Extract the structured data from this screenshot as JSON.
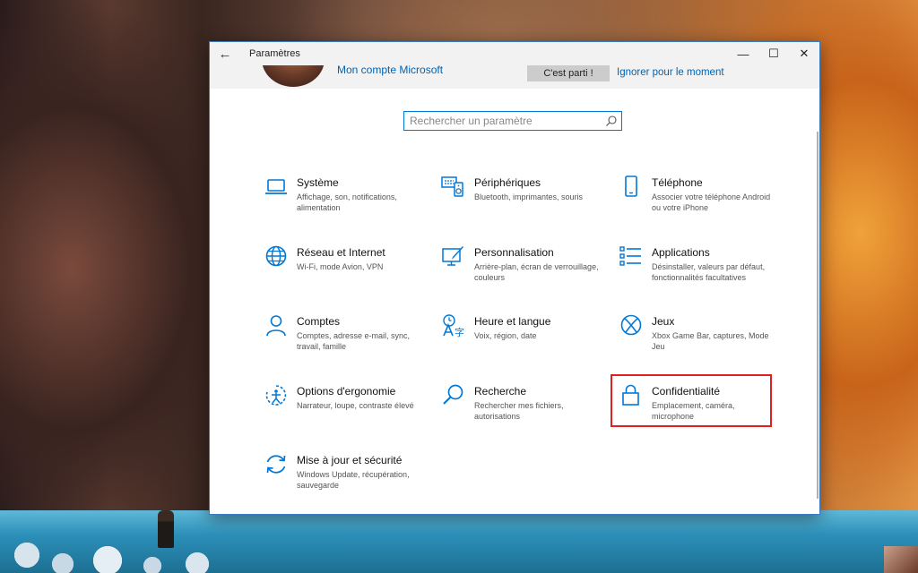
{
  "window": {
    "title": "Paramètres",
    "back_glyph": "←",
    "minimize_glyph": "—",
    "maximize_glyph": "☐",
    "close_glyph": "✕"
  },
  "banner": {
    "account_link": "Mon compte Microsoft",
    "start_button": "C'est parti !",
    "ignore_link": "Ignorer pour le moment"
  },
  "search": {
    "placeholder": "Rechercher un paramètre",
    "icon": "search-icon"
  },
  "categories": [
    {
      "label": "Système",
      "desc": "Affichage, son, notifications, alimentation",
      "icon": "laptop-icon"
    },
    {
      "label": "Périphériques",
      "desc": "Bluetooth, imprimantes, souris",
      "icon": "keyboard-speaker-icon"
    },
    {
      "label": "Téléphone",
      "desc": "Associer votre téléphone Android ou votre iPhone",
      "icon": "phone-icon"
    },
    {
      "label": "Réseau et Internet",
      "desc": "Wi-Fi, mode Avion, VPN",
      "icon": "globe-icon"
    },
    {
      "label": "Personnalisation",
      "desc": "Arrière-plan, écran de verrouillage, couleurs",
      "icon": "paint-icon"
    },
    {
      "label": "Applications",
      "desc": "Désinstaller, valeurs par défaut, fonctionnalités facultatives",
      "icon": "apps-list-icon"
    },
    {
      "label": "Comptes",
      "desc": "Comptes, adresse e-mail, sync, travail, famille",
      "icon": "person-icon"
    },
    {
      "label": "Heure et langue",
      "desc": "Voix, région, date",
      "icon": "time-language-icon"
    },
    {
      "label": "Jeux",
      "desc": "Xbox Game Bar, captures, Mode Jeu",
      "icon": "xbox-icon"
    },
    {
      "label": "Options d'ergonomie",
      "desc": "Narrateur, loupe, contraste élevé",
      "icon": "ease-of-access-icon"
    },
    {
      "label": "Recherche",
      "desc": "Rechercher mes fichiers, autorisations",
      "icon": "magnifier-icon"
    },
    {
      "label": "Confidentialité",
      "desc": "Emplacement, caméra, microphone",
      "icon": "lock-icon"
    },
    {
      "label": "Mise à jour et sécurité",
      "desc": "Windows Update, récupération, sauvegarde",
      "icon": "update-icon"
    }
  ],
  "colors": {
    "accent": "#0078d7",
    "link": "#0063b1",
    "highlight": "#e02020"
  }
}
